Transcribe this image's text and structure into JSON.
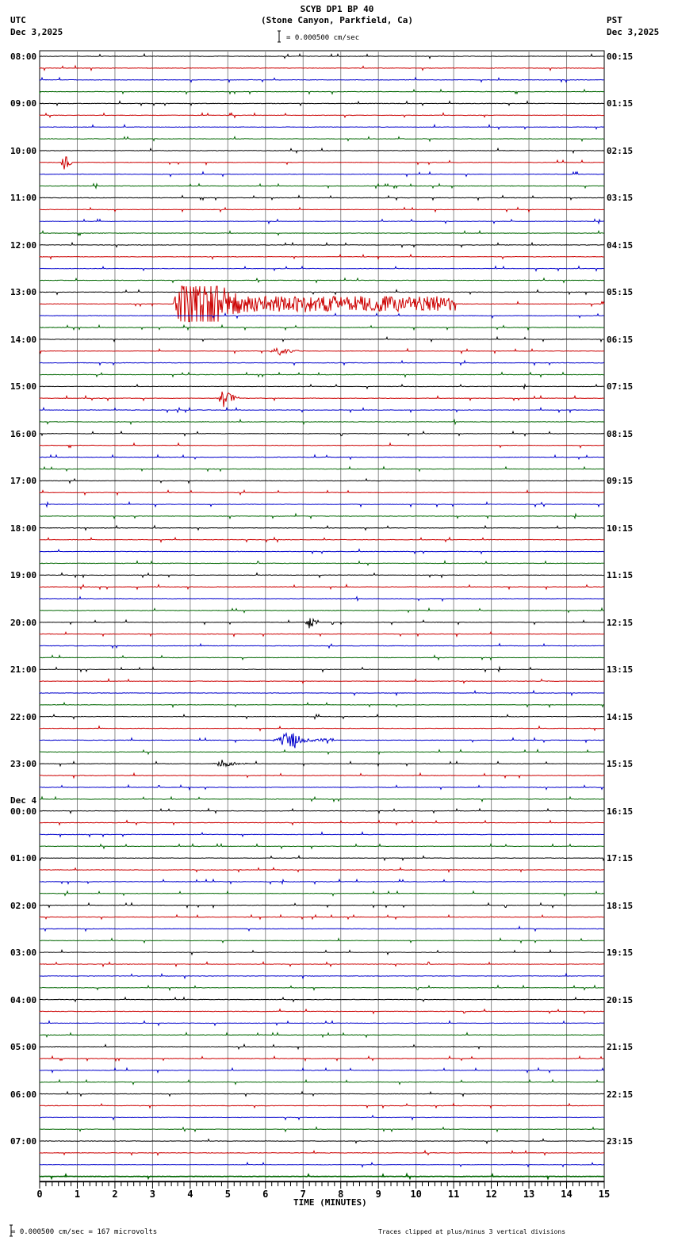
{
  "chart_data": {
    "type": "line",
    "title": "SCYB DP1 BP 40",
    "subtitle": "(Stone Canyon, Parkfield, Ca)",
    "left_timezone": "UTC",
    "left_date": "Dec 3,2025",
    "right_timezone": "PST",
    "right_date": "Dec 3,2025",
    "scale_label": "= 0.000500 cm/sec",
    "xlabel": "TIME (MINUTES)",
    "xlim": [
      0,
      15
    ],
    "x_ticks": [
      "0",
      "1",
      "2",
      "3",
      "4",
      "5",
      "6",
      "7",
      "8",
      "9",
      "10",
      "11",
      "12",
      "13",
      "14",
      "15"
    ],
    "left_labels": [
      "08:00",
      "09:00",
      "10:00",
      "11:00",
      "12:00",
      "13:00",
      "14:00",
      "15:00",
      "16:00",
      "17:00",
      "18:00",
      "19:00",
      "20:00",
      "21:00",
      "22:00",
      "23:00",
      "00:00",
      "01:00",
      "02:00",
      "03:00",
      "04:00",
      "05:00",
      "06:00",
      "07:00"
    ],
    "date_change_label": "Dec 4",
    "right_labels": [
      "00:15",
      "01:15",
      "02:15",
      "03:15",
      "04:15",
      "05:15",
      "06:15",
      "07:15",
      "08:15",
      "09:15",
      "10:15",
      "11:15",
      "12:15",
      "13:15",
      "14:15",
      "15:15",
      "16:15",
      "17:15",
      "18:15",
      "19:15",
      "20:15",
      "21:15",
      "22:15",
      "23:15"
    ],
    "traces_per_hour": 4,
    "trace_colors": [
      "#000000",
      "#cc0000",
      "#0000cc",
      "#006600"
    ],
    "events": [
      {
        "trace": 9,
        "start_min": 0.55,
        "dur_min": 0.3,
        "amp": 0.3
      },
      {
        "trace": 21,
        "start_min": 3.55,
        "dur_min": 7.5,
        "amp": 2.0,
        "peak_min": 4.0
      },
      {
        "trace": 25,
        "start_min": 6.1,
        "dur_min": 0.8,
        "amp": 0.2
      },
      {
        "trace": 29,
        "start_min": 4.7,
        "dur_min": 0.6,
        "amp": 0.35
      },
      {
        "trace": 48,
        "start_min": 7.05,
        "dur_min": 0.35,
        "amp": 0.25
      },
      {
        "trace": 58,
        "start_min": 6.2,
        "dur_min": 1.6,
        "amp": 0.4
      },
      {
        "trace": 60,
        "start_min": 4.6,
        "dur_min": 1.0,
        "amp": 0.15
      }
    ],
    "footer_scale": "= 0.000500 cm/sec =     167 microvolts",
    "footer_note": "Traces clipped at plus/minus 3 vertical divisions"
  }
}
